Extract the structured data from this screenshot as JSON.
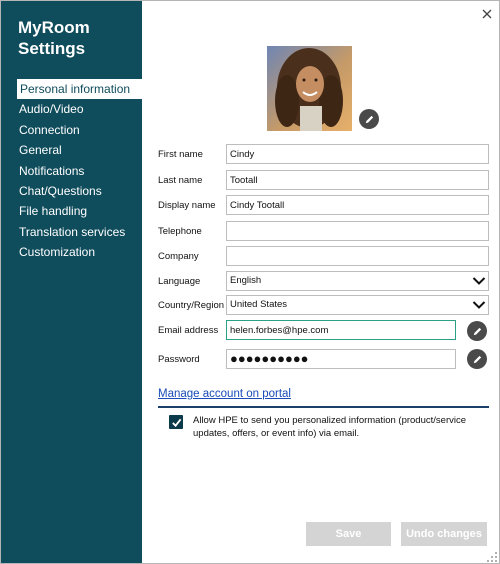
{
  "app": {
    "title": "MyRoom Settings"
  },
  "sidebar": {
    "items": [
      {
        "label": "Personal information",
        "active": true
      },
      {
        "label": "Audio/Video"
      },
      {
        "label": "Connection"
      },
      {
        "label": "General"
      },
      {
        "label": "Notifications"
      },
      {
        "label": "Chat/Questions"
      },
      {
        "label": "File handling"
      },
      {
        "label": "Translation services"
      },
      {
        "label": "Customization"
      }
    ]
  },
  "form": {
    "first_name": {
      "label": "First name",
      "value": "Cindy"
    },
    "last_name": {
      "label": "Last name",
      "value": "Tootall"
    },
    "display_name": {
      "label": "Display name",
      "value": "Cindy Tootall"
    },
    "telephone": {
      "label": "Telephone",
      "value": ""
    },
    "company": {
      "label": "Company",
      "value": ""
    },
    "language": {
      "label": "Language",
      "value": "English"
    },
    "country": {
      "label": "Country/Region",
      "value": "United States"
    },
    "email": {
      "label": "Email address",
      "value": "helen.forbes@hpe.com"
    },
    "password": {
      "label": "Password",
      "value": "●●●●●●●●●●"
    }
  },
  "links": {
    "manage_account": "Manage account on portal"
  },
  "consent": {
    "checked": true,
    "text": "Allow HPE to send you personalized information (product/service updates, offers, or event info) via email."
  },
  "buttons": {
    "save": "Save",
    "undo": "Undo changes"
  },
  "icons": {
    "close": "close-icon",
    "edit": "pencil-icon",
    "dropdown": "chevron-down-icon",
    "checkbox": "checkmark-icon"
  },
  "colors": {
    "sidebar_bg": "#0f4c5c",
    "focus_border": "#2aa184",
    "link": "#1a4bb8",
    "disabled_button": "#d4d4d4"
  }
}
